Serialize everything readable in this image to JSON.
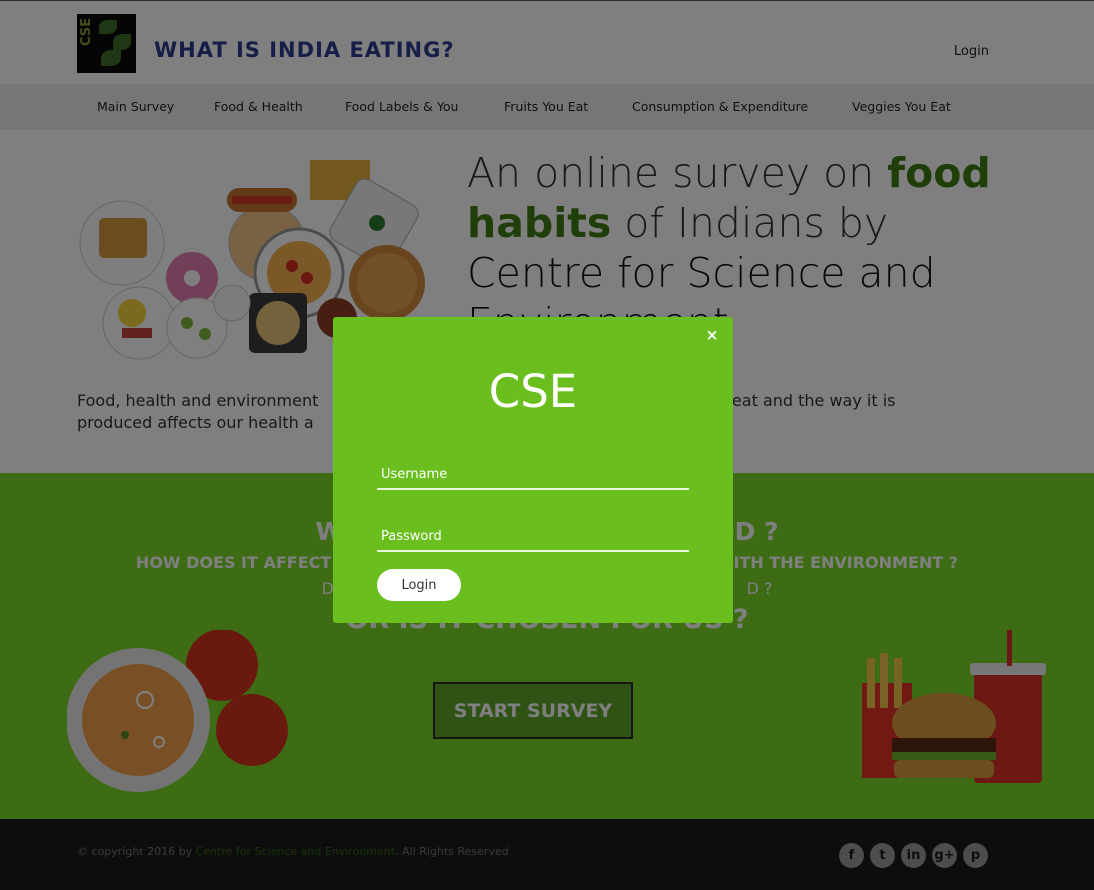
{
  "header": {
    "logo_text": "CSE",
    "site_title": "WHAT IS INDIA EATING?",
    "login_label": "Login"
  },
  "nav": {
    "items": [
      "Main Survey",
      "Food & Health",
      "Food Labels & You",
      "Fruits You Eat",
      "Consumption & Expenditure",
      "Veggies You Eat"
    ]
  },
  "hero": {
    "headline_part1": "An online survey on ",
    "headline_hl1": "food",
    "headline_hl2": "habits",
    "headline_part2": " of Indians by ",
    "headline_part3": "Centre for Science and Environment",
    "body_left": "Food, health and environment",
    "body_right": "e eat and the way it is",
    "body_line2_left": "produced affects our health a"
  },
  "band": {
    "q1_left": "WHA",
    "q1_right": "OD ?",
    "q2_left": "HOW DOES IT AFFECT OUR",
    "q2_right": "WITH THE ENVIRONMENT ?",
    "q3_left": "DO",
    "q3_right": "D ?",
    "q4": "OR IS IT CHOSEN FOR US ?",
    "start_label": "START SURVEY"
  },
  "footer": {
    "copyright_prefix": "© copyright 2016 by ",
    "org": "Centre for Science and Environment",
    "copyright_suffix": ". All Rights Reserved",
    "social": [
      "facebook-icon",
      "twitter-icon",
      "linkedin-icon",
      "google-plus-icon",
      "pinterest-icon"
    ]
  },
  "modal": {
    "close_glyph": "×",
    "title": "CSE",
    "username_placeholder": "Username",
    "password_placeholder": "Password",
    "login_label": "Login"
  },
  "colors": {
    "accent_green": "#6abf1f",
    "band_green": "#7cd92a",
    "title_blue": "#2c3a8c",
    "highlight_green": "#3f7d12"
  }
}
